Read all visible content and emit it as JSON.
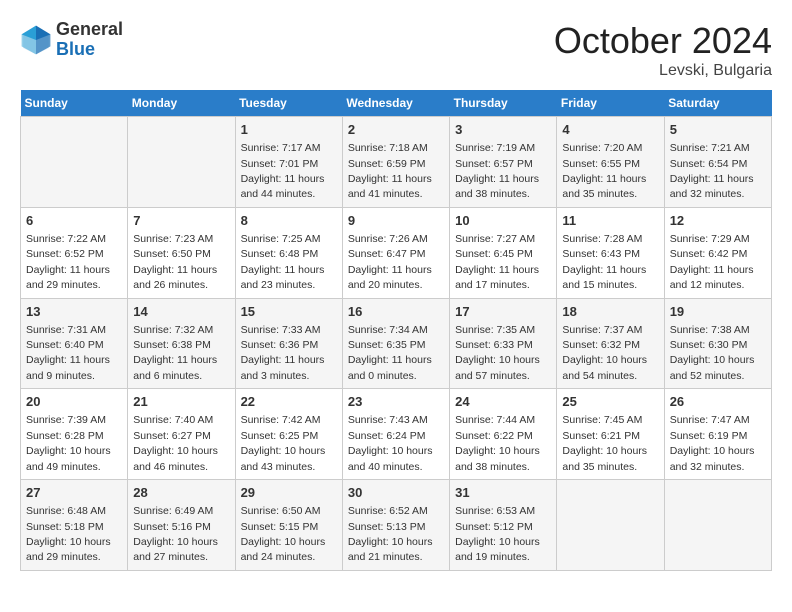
{
  "header": {
    "logo_general": "General",
    "logo_blue": "Blue",
    "month_title": "October 2024",
    "location": "Levski, Bulgaria"
  },
  "days_of_week": [
    "Sunday",
    "Monday",
    "Tuesday",
    "Wednesday",
    "Thursday",
    "Friday",
    "Saturday"
  ],
  "weeks": [
    [
      {
        "day": "",
        "sunrise": "",
        "sunset": "",
        "daylight": ""
      },
      {
        "day": "",
        "sunrise": "",
        "sunset": "",
        "daylight": ""
      },
      {
        "day": "1",
        "sunrise": "Sunrise: 7:17 AM",
        "sunset": "Sunset: 7:01 PM",
        "daylight": "Daylight: 11 hours and 44 minutes."
      },
      {
        "day": "2",
        "sunrise": "Sunrise: 7:18 AM",
        "sunset": "Sunset: 6:59 PM",
        "daylight": "Daylight: 11 hours and 41 minutes."
      },
      {
        "day": "3",
        "sunrise": "Sunrise: 7:19 AM",
        "sunset": "Sunset: 6:57 PM",
        "daylight": "Daylight: 11 hours and 38 minutes."
      },
      {
        "day": "4",
        "sunrise": "Sunrise: 7:20 AM",
        "sunset": "Sunset: 6:55 PM",
        "daylight": "Daylight: 11 hours and 35 minutes."
      },
      {
        "day": "5",
        "sunrise": "Sunrise: 7:21 AM",
        "sunset": "Sunset: 6:54 PM",
        "daylight": "Daylight: 11 hours and 32 minutes."
      }
    ],
    [
      {
        "day": "6",
        "sunrise": "Sunrise: 7:22 AM",
        "sunset": "Sunset: 6:52 PM",
        "daylight": "Daylight: 11 hours and 29 minutes."
      },
      {
        "day": "7",
        "sunrise": "Sunrise: 7:23 AM",
        "sunset": "Sunset: 6:50 PM",
        "daylight": "Daylight: 11 hours and 26 minutes."
      },
      {
        "day": "8",
        "sunrise": "Sunrise: 7:25 AM",
        "sunset": "Sunset: 6:48 PM",
        "daylight": "Daylight: 11 hours and 23 minutes."
      },
      {
        "day": "9",
        "sunrise": "Sunrise: 7:26 AM",
        "sunset": "Sunset: 6:47 PM",
        "daylight": "Daylight: 11 hours and 20 minutes."
      },
      {
        "day": "10",
        "sunrise": "Sunrise: 7:27 AM",
        "sunset": "Sunset: 6:45 PM",
        "daylight": "Daylight: 11 hours and 17 minutes."
      },
      {
        "day": "11",
        "sunrise": "Sunrise: 7:28 AM",
        "sunset": "Sunset: 6:43 PM",
        "daylight": "Daylight: 11 hours and 15 minutes."
      },
      {
        "day": "12",
        "sunrise": "Sunrise: 7:29 AM",
        "sunset": "Sunset: 6:42 PM",
        "daylight": "Daylight: 11 hours and 12 minutes."
      }
    ],
    [
      {
        "day": "13",
        "sunrise": "Sunrise: 7:31 AM",
        "sunset": "Sunset: 6:40 PM",
        "daylight": "Daylight: 11 hours and 9 minutes."
      },
      {
        "day": "14",
        "sunrise": "Sunrise: 7:32 AM",
        "sunset": "Sunset: 6:38 PM",
        "daylight": "Daylight: 11 hours and 6 minutes."
      },
      {
        "day": "15",
        "sunrise": "Sunrise: 7:33 AM",
        "sunset": "Sunset: 6:36 PM",
        "daylight": "Daylight: 11 hours and 3 minutes."
      },
      {
        "day": "16",
        "sunrise": "Sunrise: 7:34 AM",
        "sunset": "Sunset: 6:35 PM",
        "daylight": "Daylight: 11 hours and 0 minutes."
      },
      {
        "day": "17",
        "sunrise": "Sunrise: 7:35 AM",
        "sunset": "Sunset: 6:33 PM",
        "daylight": "Daylight: 10 hours and 57 minutes."
      },
      {
        "day": "18",
        "sunrise": "Sunrise: 7:37 AM",
        "sunset": "Sunset: 6:32 PM",
        "daylight": "Daylight: 10 hours and 54 minutes."
      },
      {
        "day": "19",
        "sunrise": "Sunrise: 7:38 AM",
        "sunset": "Sunset: 6:30 PM",
        "daylight": "Daylight: 10 hours and 52 minutes."
      }
    ],
    [
      {
        "day": "20",
        "sunrise": "Sunrise: 7:39 AM",
        "sunset": "Sunset: 6:28 PM",
        "daylight": "Daylight: 10 hours and 49 minutes."
      },
      {
        "day": "21",
        "sunrise": "Sunrise: 7:40 AM",
        "sunset": "Sunset: 6:27 PM",
        "daylight": "Daylight: 10 hours and 46 minutes."
      },
      {
        "day": "22",
        "sunrise": "Sunrise: 7:42 AM",
        "sunset": "Sunset: 6:25 PM",
        "daylight": "Daylight: 10 hours and 43 minutes."
      },
      {
        "day": "23",
        "sunrise": "Sunrise: 7:43 AM",
        "sunset": "Sunset: 6:24 PM",
        "daylight": "Daylight: 10 hours and 40 minutes."
      },
      {
        "day": "24",
        "sunrise": "Sunrise: 7:44 AM",
        "sunset": "Sunset: 6:22 PM",
        "daylight": "Daylight: 10 hours and 38 minutes."
      },
      {
        "day": "25",
        "sunrise": "Sunrise: 7:45 AM",
        "sunset": "Sunset: 6:21 PM",
        "daylight": "Daylight: 10 hours and 35 minutes."
      },
      {
        "day": "26",
        "sunrise": "Sunrise: 7:47 AM",
        "sunset": "Sunset: 6:19 PM",
        "daylight": "Daylight: 10 hours and 32 minutes."
      }
    ],
    [
      {
        "day": "27",
        "sunrise": "Sunrise: 6:48 AM",
        "sunset": "Sunset: 5:18 PM",
        "daylight": "Daylight: 10 hours and 29 minutes."
      },
      {
        "day": "28",
        "sunrise": "Sunrise: 6:49 AM",
        "sunset": "Sunset: 5:16 PM",
        "daylight": "Daylight: 10 hours and 27 minutes."
      },
      {
        "day": "29",
        "sunrise": "Sunrise: 6:50 AM",
        "sunset": "Sunset: 5:15 PM",
        "daylight": "Daylight: 10 hours and 24 minutes."
      },
      {
        "day": "30",
        "sunrise": "Sunrise: 6:52 AM",
        "sunset": "Sunset: 5:13 PM",
        "daylight": "Daylight: 10 hours and 21 minutes."
      },
      {
        "day": "31",
        "sunrise": "Sunrise: 6:53 AM",
        "sunset": "Sunset: 5:12 PM",
        "daylight": "Daylight: 10 hours and 19 minutes."
      },
      {
        "day": "",
        "sunrise": "",
        "sunset": "",
        "daylight": ""
      },
      {
        "day": "",
        "sunrise": "",
        "sunset": "",
        "daylight": ""
      }
    ]
  ]
}
